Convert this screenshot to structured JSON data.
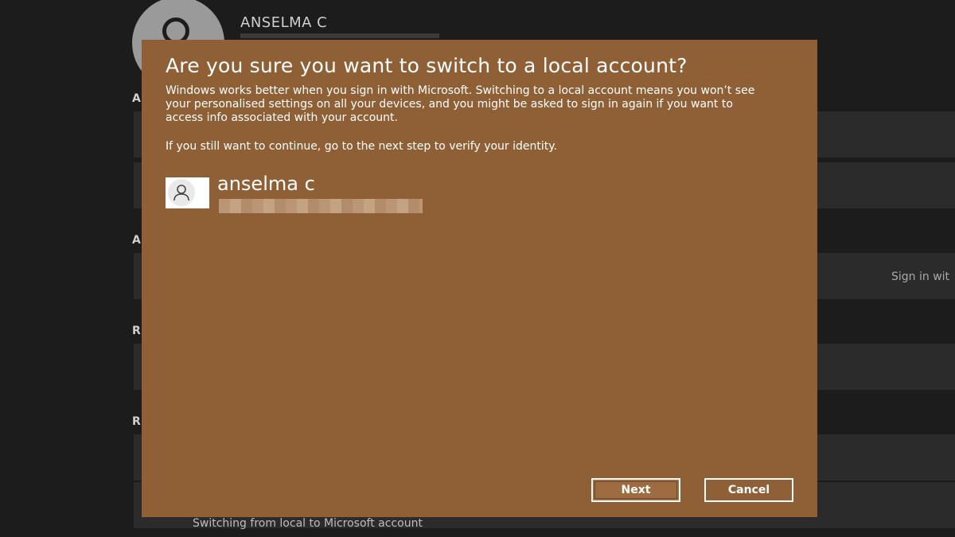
{
  "background": {
    "account_name": "ANSELMA C",
    "sign_in_text": "Sign in wit",
    "bottom_link": "Switching from local to Microsoft account",
    "section_letters": [
      "A",
      "A",
      "R",
      "R"
    ]
  },
  "dialog": {
    "title": "Are you sure you want to switch to a local account?",
    "body": "Windows works better when you sign in with Microsoft. Switching to a local account means you won’t see your personalised settings on all your devices, and you might be asked to sign in again if you want to access info associated with your account.",
    "body2": "If you still want to continue, go to the next step to verify your identity.",
    "account": {
      "name": "anselma c",
      "avatar_icon": "person-icon"
    },
    "buttons": {
      "next": "Next",
      "cancel": "Cancel"
    },
    "colors": {
      "background": "#8f6036",
      "text": "#ffffff"
    }
  }
}
